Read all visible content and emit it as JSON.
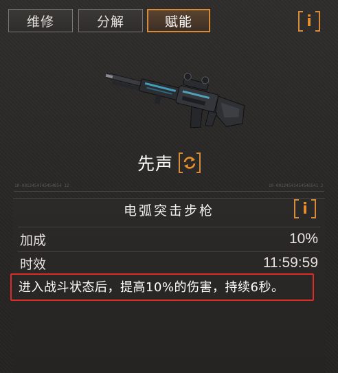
{
  "tabs": [
    {
      "label": "维修",
      "active": false
    },
    {
      "label": "分解",
      "active": false
    },
    {
      "label": "赋能",
      "active": true
    }
  ],
  "info_icon": "info-icon",
  "weapon": {
    "name": "先声",
    "swap_icon": "swap-icon",
    "code_left": "10-0012454145454854 12",
    "code_right": "10-00124541454546541 2"
  },
  "detail": {
    "title": "电弧突击步枪",
    "stats": [
      {
        "label": "加成",
        "value": "10%"
      },
      {
        "label": "时效",
        "value": "11:59:59"
      }
    ],
    "effect": "进入战斗状态后，提高10%的伤害，持续6秒。"
  },
  "colors": {
    "accent": "#d88c3a",
    "highlight_border": "#e02a25",
    "background": "#2a2826"
  }
}
